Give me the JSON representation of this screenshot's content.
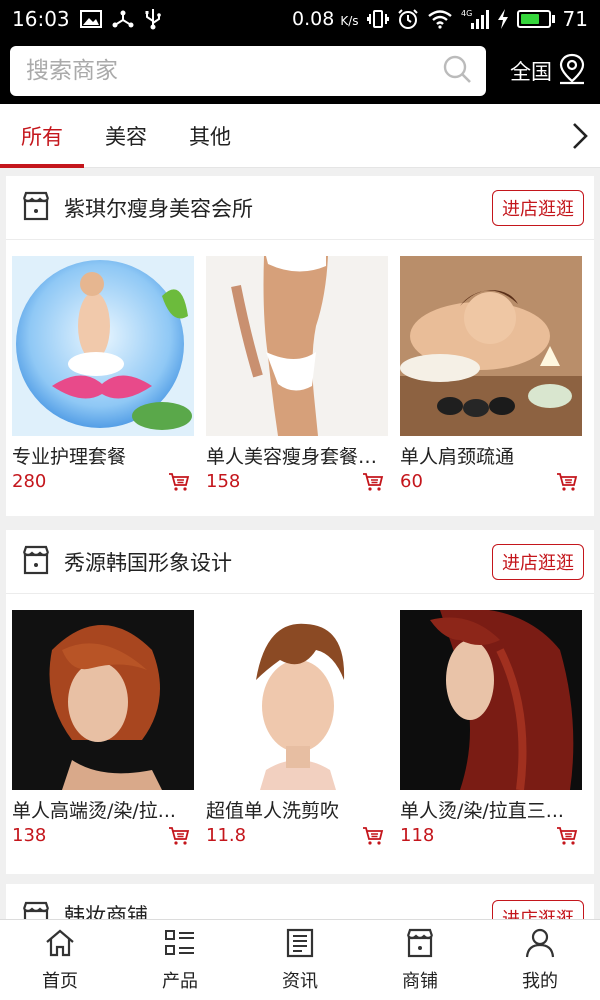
{
  "status_bar": {
    "time": "16:03",
    "net_speed": "0.08",
    "net_unit": "K/s",
    "battery_level": "71",
    "battery_fraction": 0.71,
    "icons": [
      "image-icon",
      "share-icon",
      "usb-icon",
      "vibrate-icon",
      "alarm-icon",
      "wifi-icon",
      "signal-4g-icon",
      "charging-icon",
      "battery-icon"
    ]
  },
  "search": {
    "placeholder": "搜索商家",
    "region_label": "全国"
  },
  "tabs": [
    {
      "label": "所有",
      "active": true
    },
    {
      "label": "美容",
      "active": false
    },
    {
      "label": "其他",
      "active": false
    }
  ],
  "shops": [
    {
      "name": "紫琪尔瘦身美容会所",
      "enter_label": "进店逛逛",
      "products": [
        {
          "name": "专业护理套餐",
          "price": "280"
        },
        {
          "name": "单人美容瘦身套餐1...",
          "price": "158"
        },
        {
          "name": "单人肩颈疏通",
          "price": "60"
        }
      ]
    },
    {
      "name": "秀源韩国形象设计",
      "enter_label": "进店逛逛",
      "products": [
        {
          "name": "单人高端烫/染/拉...",
          "price": "138"
        },
        {
          "name": "超值单人洗剪吹",
          "price": "11.8"
        },
        {
          "name": "单人烫/染/拉直三...",
          "price": "118"
        }
      ]
    },
    {
      "name": "韩妆商铺",
      "enter_label": "进店逛逛",
      "products": []
    }
  ],
  "bottom_nav": [
    {
      "label": "首页",
      "icon": "home-icon"
    },
    {
      "label": "产品",
      "icon": "product-list-icon"
    },
    {
      "label": "资讯",
      "icon": "news-icon"
    },
    {
      "label": "商铺",
      "icon": "store-icon"
    },
    {
      "label": "我的",
      "icon": "user-icon"
    }
  ],
  "colors": {
    "accent": "#c4161c",
    "header_bg": "#000000",
    "battery_green": "#35d53b"
  }
}
